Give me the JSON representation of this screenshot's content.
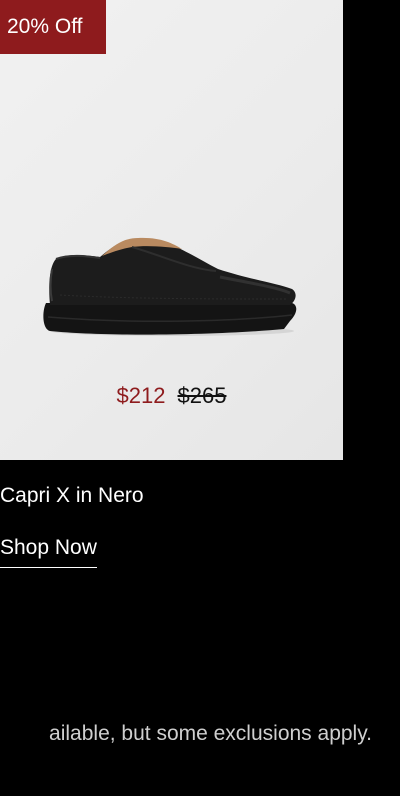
{
  "promo": {
    "badge_label": "20% Off"
  },
  "product": {
    "name": "Capri X in Nero",
    "sale_price": "$212",
    "original_price": "$265",
    "image_icon": "black-sneaker-image",
    "cta_label": "Shop Now"
  },
  "footer_note": {
    "text": "ailable, but some exclusions apply."
  },
  "colors": {
    "background": "#000000",
    "badge": "#8e1b1d",
    "sale_price": "#8e1b1d",
    "card": "#eeeeee"
  }
}
